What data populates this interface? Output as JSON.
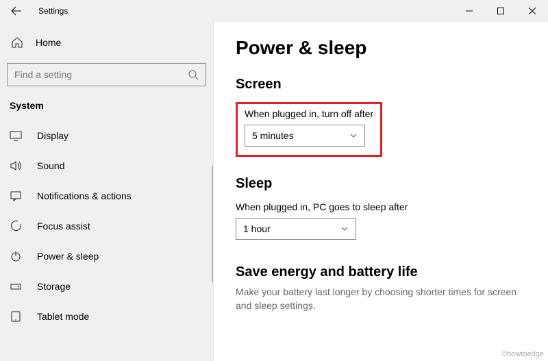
{
  "window": {
    "title": "Settings"
  },
  "sidebar": {
    "home": "Home",
    "search_placeholder": "Find a setting",
    "section": "System",
    "items": [
      {
        "icon": "display",
        "label": "Display"
      },
      {
        "icon": "sound",
        "label": "Sound"
      },
      {
        "icon": "notifications",
        "label": "Notifications & actions"
      },
      {
        "icon": "focus",
        "label": "Focus assist"
      },
      {
        "icon": "power",
        "label": "Power & sleep"
      },
      {
        "icon": "storage",
        "label": "Storage"
      },
      {
        "icon": "tablet",
        "label": "Tablet mode"
      }
    ]
  },
  "main": {
    "heading": "Power & sleep",
    "screen": {
      "title": "Screen",
      "label": "When plugged in, turn off after",
      "value": "5 minutes"
    },
    "sleep": {
      "title": "Sleep",
      "label": "When plugged in, PC goes to sleep after",
      "value": "1 hour"
    },
    "tip": {
      "title": "Save energy and battery life",
      "body": "Make your battery last longer by choosing shorter times for screen and sleep settings."
    }
  },
  "watermark": "©howtoedge"
}
